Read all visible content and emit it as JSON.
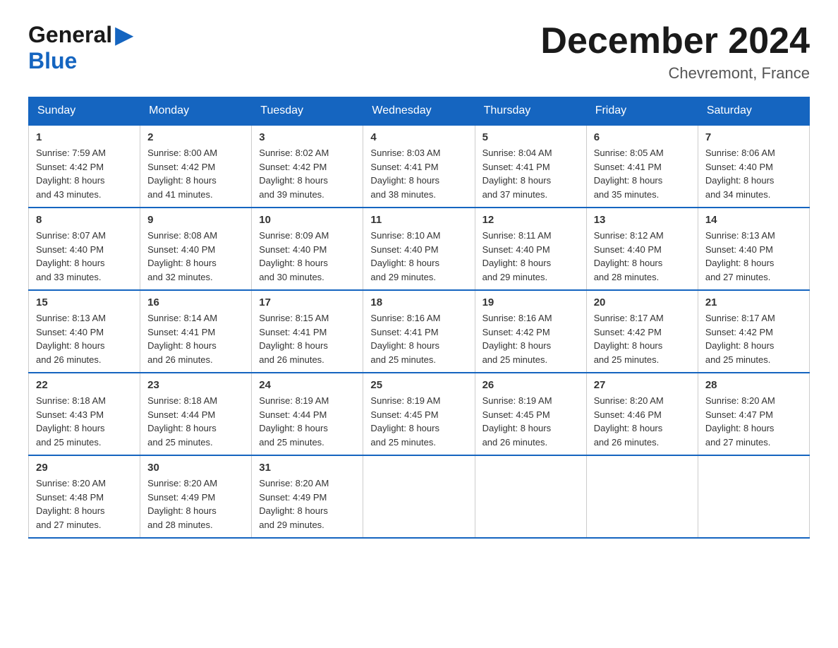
{
  "header": {
    "logo_general": "General",
    "logo_blue": "Blue",
    "month_title": "December 2024",
    "location": "Chevremont, France"
  },
  "weekdays": [
    "Sunday",
    "Monday",
    "Tuesday",
    "Wednesday",
    "Thursday",
    "Friday",
    "Saturday"
  ],
  "weeks": [
    [
      {
        "day": "1",
        "sunrise": "7:59 AM",
        "sunset": "4:42 PM",
        "daylight": "8 hours and 43 minutes."
      },
      {
        "day": "2",
        "sunrise": "8:00 AM",
        "sunset": "4:42 PM",
        "daylight": "8 hours and 41 minutes."
      },
      {
        "day": "3",
        "sunrise": "8:02 AM",
        "sunset": "4:42 PM",
        "daylight": "8 hours and 39 minutes."
      },
      {
        "day": "4",
        "sunrise": "8:03 AM",
        "sunset": "4:41 PM",
        "daylight": "8 hours and 38 minutes."
      },
      {
        "day": "5",
        "sunrise": "8:04 AM",
        "sunset": "4:41 PM",
        "daylight": "8 hours and 37 minutes."
      },
      {
        "day": "6",
        "sunrise": "8:05 AM",
        "sunset": "4:41 PM",
        "daylight": "8 hours and 35 minutes."
      },
      {
        "day": "7",
        "sunrise": "8:06 AM",
        "sunset": "4:40 PM",
        "daylight": "8 hours and 34 minutes."
      }
    ],
    [
      {
        "day": "8",
        "sunrise": "8:07 AM",
        "sunset": "4:40 PM",
        "daylight": "8 hours and 33 minutes."
      },
      {
        "day": "9",
        "sunrise": "8:08 AM",
        "sunset": "4:40 PM",
        "daylight": "8 hours and 32 minutes."
      },
      {
        "day": "10",
        "sunrise": "8:09 AM",
        "sunset": "4:40 PM",
        "daylight": "8 hours and 30 minutes."
      },
      {
        "day": "11",
        "sunrise": "8:10 AM",
        "sunset": "4:40 PM",
        "daylight": "8 hours and 29 minutes."
      },
      {
        "day": "12",
        "sunrise": "8:11 AM",
        "sunset": "4:40 PM",
        "daylight": "8 hours and 29 minutes."
      },
      {
        "day": "13",
        "sunrise": "8:12 AM",
        "sunset": "4:40 PM",
        "daylight": "8 hours and 28 minutes."
      },
      {
        "day": "14",
        "sunrise": "8:13 AM",
        "sunset": "4:40 PM",
        "daylight": "8 hours and 27 minutes."
      }
    ],
    [
      {
        "day": "15",
        "sunrise": "8:13 AM",
        "sunset": "4:40 PM",
        "daylight": "8 hours and 26 minutes."
      },
      {
        "day": "16",
        "sunrise": "8:14 AM",
        "sunset": "4:41 PM",
        "daylight": "8 hours and 26 minutes."
      },
      {
        "day": "17",
        "sunrise": "8:15 AM",
        "sunset": "4:41 PM",
        "daylight": "8 hours and 26 minutes."
      },
      {
        "day": "18",
        "sunrise": "8:16 AM",
        "sunset": "4:41 PM",
        "daylight": "8 hours and 25 minutes."
      },
      {
        "day": "19",
        "sunrise": "8:16 AM",
        "sunset": "4:42 PM",
        "daylight": "8 hours and 25 minutes."
      },
      {
        "day": "20",
        "sunrise": "8:17 AM",
        "sunset": "4:42 PM",
        "daylight": "8 hours and 25 minutes."
      },
      {
        "day": "21",
        "sunrise": "8:17 AM",
        "sunset": "4:42 PM",
        "daylight": "8 hours and 25 minutes."
      }
    ],
    [
      {
        "day": "22",
        "sunrise": "8:18 AM",
        "sunset": "4:43 PM",
        "daylight": "8 hours and 25 minutes."
      },
      {
        "day": "23",
        "sunrise": "8:18 AM",
        "sunset": "4:44 PM",
        "daylight": "8 hours and 25 minutes."
      },
      {
        "day": "24",
        "sunrise": "8:19 AM",
        "sunset": "4:44 PM",
        "daylight": "8 hours and 25 minutes."
      },
      {
        "day": "25",
        "sunrise": "8:19 AM",
        "sunset": "4:45 PM",
        "daylight": "8 hours and 25 minutes."
      },
      {
        "day": "26",
        "sunrise": "8:19 AM",
        "sunset": "4:45 PM",
        "daylight": "8 hours and 26 minutes."
      },
      {
        "day": "27",
        "sunrise": "8:20 AM",
        "sunset": "4:46 PM",
        "daylight": "8 hours and 26 minutes."
      },
      {
        "day": "28",
        "sunrise": "8:20 AM",
        "sunset": "4:47 PM",
        "daylight": "8 hours and 27 minutes."
      }
    ],
    [
      {
        "day": "29",
        "sunrise": "8:20 AM",
        "sunset": "4:48 PM",
        "daylight": "8 hours and 27 minutes."
      },
      {
        "day": "30",
        "sunrise": "8:20 AM",
        "sunset": "4:49 PM",
        "daylight": "8 hours and 28 minutes."
      },
      {
        "day": "31",
        "sunrise": "8:20 AM",
        "sunset": "4:49 PM",
        "daylight": "8 hours and 29 minutes."
      },
      null,
      null,
      null,
      null
    ]
  ],
  "labels": {
    "sunrise": "Sunrise:",
    "sunset": "Sunset:",
    "daylight": "Daylight:"
  }
}
